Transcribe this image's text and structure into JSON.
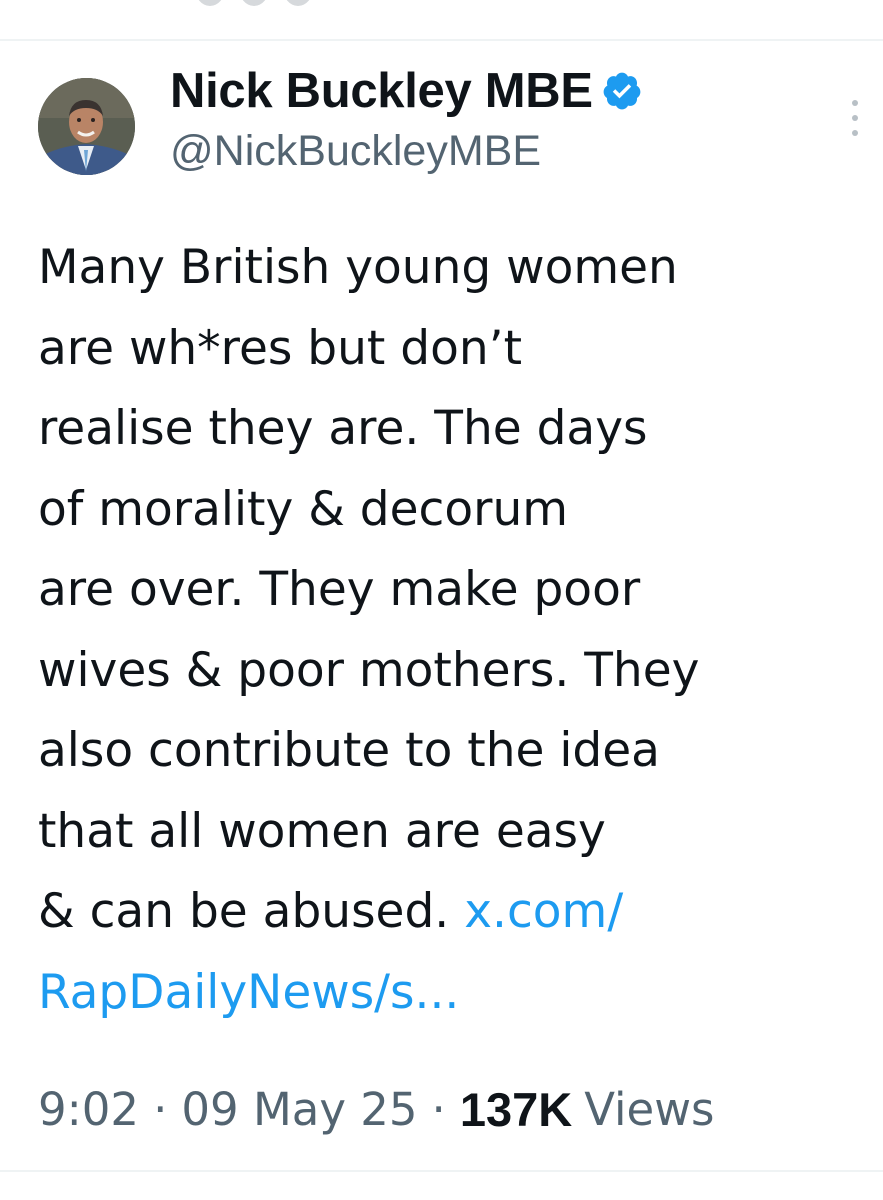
{
  "author": {
    "display_name": "Nick Buckley MBE",
    "handle": "@NickBuckleyMBE",
    "verified": true,
    "badge_color": "#1d9bf0"
  },
  "tweet": {
    "lines": [
      "Many British young women",
      "are wh*res but don’t",
      "realise they are. The days",
      "of morality & decorum",
      "are over. They make poor",
      "wives & poor mothers. They",
      "also contribute to the idea",
      "that all women are easy",
      "& can be abused. "
    ],
    "link_part1": "x.com/",
    "link_part2": "RapDailyNews/s..."
  },
  "meta": {
    "time": "9:02",
    "separator": "·",
    "date": "09 May 25",
    "views_count": "137K",
    "views_label": "Views"
  },
  "colors": {
    "text": "#0f1419",
    "secondary": "#536471",
    "link": "#1d9bf0",
    "divider": "#eff3f4"
  }
}
